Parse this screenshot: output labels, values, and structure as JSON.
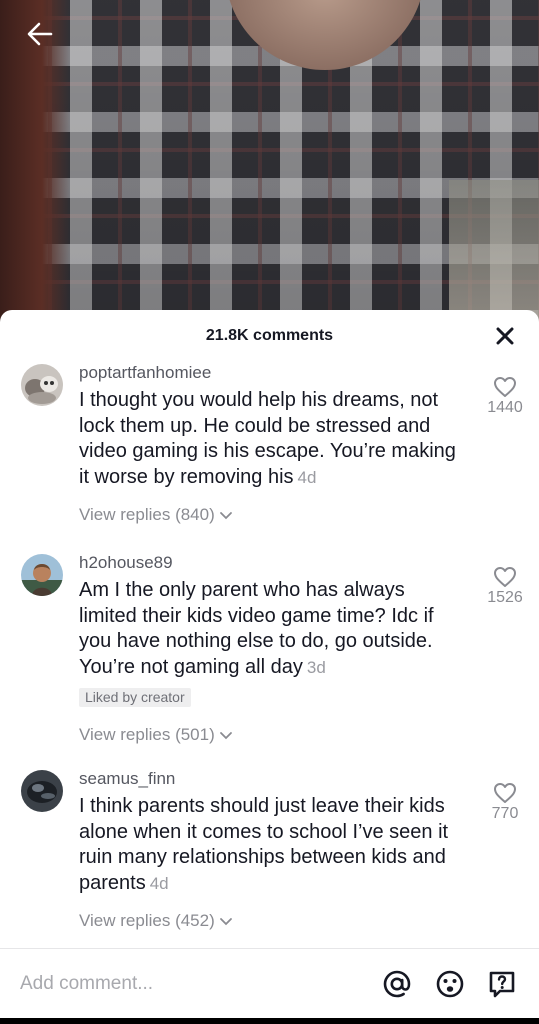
{
  "header": {
    "comment_count": "21.8K comments"
  },
  "input": {
    "placeholder": "Add comment..."
  },
  "comments": [
    {
      "username": "poptartfanhomiee",
      "text": "I thought you would help his dreams, not lock them up. He could be stressed and video gaming is his escape. You’re making it worse by removing his",
      "time": "4d",
      "likes": "1440",
      "liked_by_creator": "",
      "view_replies": "View replies (840)"
    },
    {
      "username": "h2ohouse89",
      "text": "Am I the only parent who has always limited their kids video game time? Idc if you have nothing else to do, go outside. You’re not gaming all day",
      "time": "3d",
      "likes": "1526",
      "liked_by_creator": "Liked by creator",
      "view_replies": "View replies (501)"
    },
    {
      "username": "seamus_finn",
      "text": "I think parents should just leave their kids alone when it comes to school I’ve seen it ruin many relationships between kids and parents",
      "time": "4d",
      "likes": "770",
      "liked_by_creator": "",
      "view_replies": "View replies (452)"
    }
  ],
  "icons": {
    "back": "back-arrow-icon",
    "close": "close-icon",
    "like": "heart-icon",
    "replies_chevron": "chevron-down-icon",
    "mention": "at-sign-icon",
    "emoji": "emoji-icon",
    "question": "question-icon"
  },
  "colors": {
    "text_primary": "#161823",
    "text_secondary": "#8a8b91"
  }
}
